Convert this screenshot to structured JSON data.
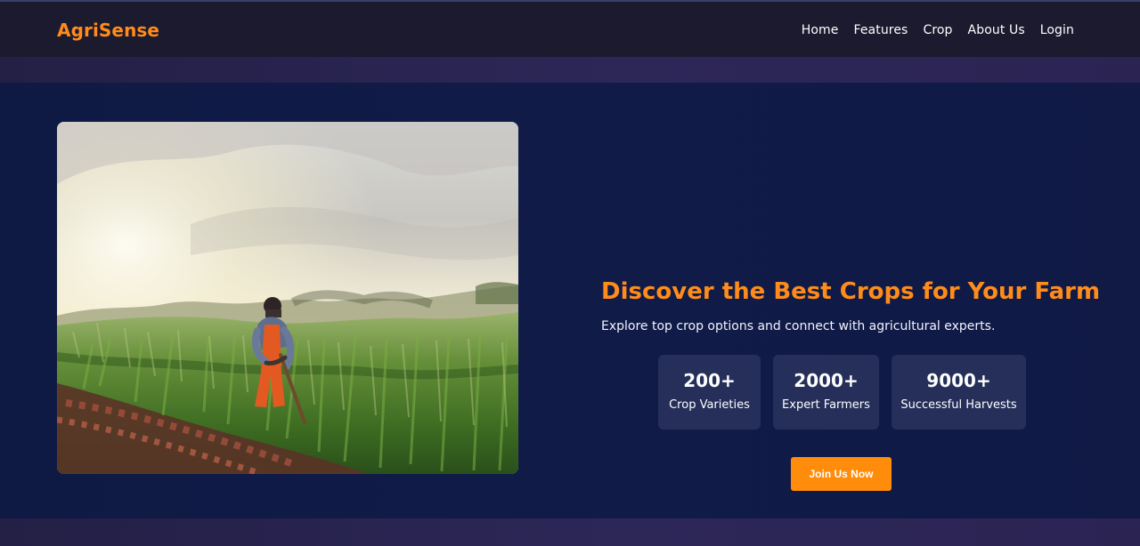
{
  "header": {
    "brand": "AgriSense",
    "nav": [
      "Home",
      "Features",
      "Crop",
      "About Us",
      "Login"
    ]
  },
  "hero": {
    "title": "Discover the Best Crops for Your Farm",
    "subtitle": "Explore top crop options and connect with agricultural experts.",
    "stats": [
      {
        "value": "200+",
        "label": "Crop Varieties"
      },
      {
        "value": "2000+",
        "label": "Expert Farmers"
      },
      {
        "value": "9000+",
        "label": "Successful Harvests"
      }
    ],
    "cta": "Join Us Now"
  },
  "colors": {
    "accent": "#ff8c1a",
    "navbar": "#1b1a2f",
    "hero": "#101b48",
    "card": "#252f5a"
  }
}
